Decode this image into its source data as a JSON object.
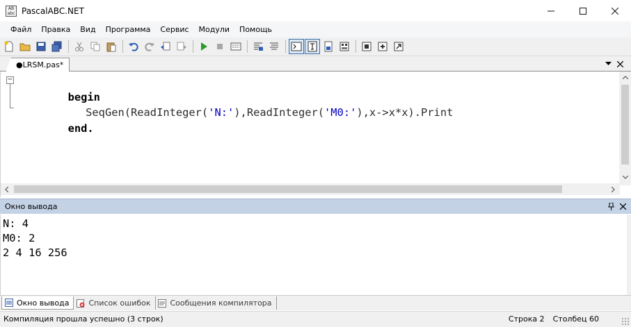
{
  "window": {
    "title": "PascalABC.NET",
    "icon_text": "AB abc",
    "controls": [
      "minimize-icon",
      "maximize-icon",
      "close-icon"
    ]
  },
  "menu": {
    "items": [
      "Файл",
      "Правка",
      "Вид",
      "Программа",
      "Сервис",
      "Модули",
      "Помощь"
    ]
  },
  "toolbar": {
    "buttons": [
      "new-file-icon",
      "open-folder-icon",
      "save-icon",
      "save-all-icon",
      "cut-icon",
      "copy-icon",
      "paste-icon",
      "undo-icon",
      "redo-icon",
      "nav-back-icon",
      "nav-forward-icon",
      "run-icon",
      "stop-icon",
      "compile-icon",
      "comment-icon",
      "uncomment-icon",
      "console-icon",
      "text-mode-icon",
      "split-icon",
      "form-icon",
      "step-icon",
      "step-over-icon",
      "step-out-icon"
    ]
  },
  "editor": {
    "tab_label": "●LRSM.pas*",
    "tab_controls": [
      "chevron-down-icon",
      "close-icon"
    ],
    "code": {
      "line1_kw": "begin",
      "line2_pre": "  SeqGen(ReadInteger(",
      "line2_str1": "'N:'",
      "line2_mid": "),ReadInteger(",
      "line2_str2": "'M0:'",
      "line2_post": "),x->x*x).Print",
      "line3_kw": "end",
      "line3_dot": "."
    }
  },
  "output_panel": {
    "title": "Окно вывода",
    "lines": [
      "N: 4",
      "M0: 2",
      "2 4 16 256"
    ]
  },
  "bottom_tabs": [
    {
      "label": "Окно вывода",
      "active": true
    },
    {
      "label": "Список ошибок",
      "active": false
    },
    {
      "label": "Сообщения компилятора",
      "active": false
    }
  ],
  "status": {
    "message": "Компиляция прошла успешно (3 строк)",
    "row_label": "Строка",
    "row_value": "2",
    "col_label": "Столбец",
    "col_value": "60"
  },
  "colors": {
    "string_literal": "#0000c0",
    "panel_header": "#c4d2e6",
    "run_green": "#2e9a2e"
  }
}
